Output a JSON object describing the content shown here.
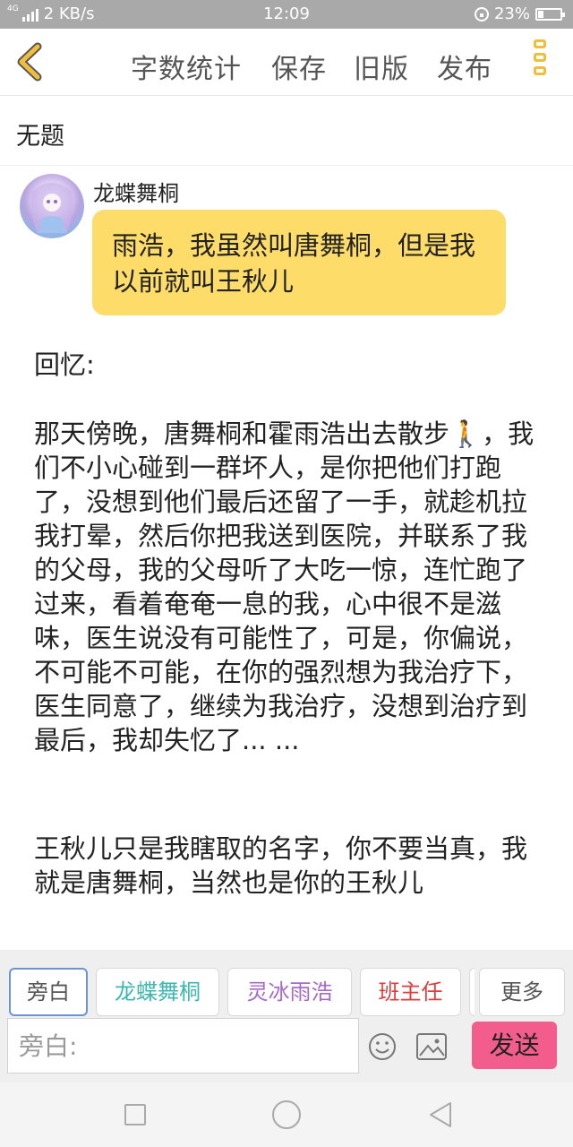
{
  "status_bar": {
    "network": "4G",
    "speed": "2 KB/s",
    "time": "12:09",
    "battery": "23%",
    "battery_level": 0.23
  },
  "toolbar": {
    "back_icon": "chevron-left-icon",
    "items": [
      "字数统计",
      "保存",
      "旧版",
      "发布"
    ],
    "menu_icon": "more-vertical-icon",
    "accent_color": "#f1be3b"
  },
  "document": {
    "title": "无题"
  },
  "message": {
    "sender": "龙蝶舞桐",
    "text": "雨浩，我虽然叫唐舞桐，但是我以前就叫王秋儿",
    "bubble_color": "#fedc6a"
  },
  "narration": {
    "heading": "回忆:",
    "paragraph1_prefix": "那天傍晚，唐舞桐和霍雨浩出去散步",
    "walking_emoji": "🚶",
    "paragraph1_rest": "，我们不小心碰到一群坏人，是你把他们打跑了，没想到他们最后还留了一手，就趁机拉我打晕，然后你把我送到医院，并联系了我的父母，我的父母听了大吃一惊，连忙跑了过来，看着奄奄一息的我，心中很不是滋味，医生说没有可能性了，可是，你偏说，不可能不可能，在你的强烈想为我治疗下，医生同意了，继续为我治疗，没想到治疗到最后，我却失忆了... ...",
    "paragraph2": "王秋儿只是我瞎取的名字，你不要当真，我就是唐舞桐，当然也是你的王秋儿"
  },
  "roles": [
    {
      "label": "旁白",
      "color": "#555555",
      "active": true
    },
    {
      "label": "龙蝶舞桐",
      "color": "#3bb9b0",
      "active": false
    },
    {
      "label": "灵冰雨浩",
      "color": "#a66bc9",
      "active": false
    },
    {
      "label": "班主任",
      "color": "#e23c3c",
      "active": false
    },
    {
      "label": "更多",
      "color": "#555555",
      "active": false
    }
  ],
  "composer": {
    "placeholder": "旁白:",
    "emoji_icon": "smile-icon",
    "image_icon": "image-icon",
    "send_label": "发送",
    "send_color": "#f25d8e"
  },
  "nav_bar": {
    "icons": [
      "recent-apps-icon",
      "home-icon",
      "back-icon"
    ]
  }
}
